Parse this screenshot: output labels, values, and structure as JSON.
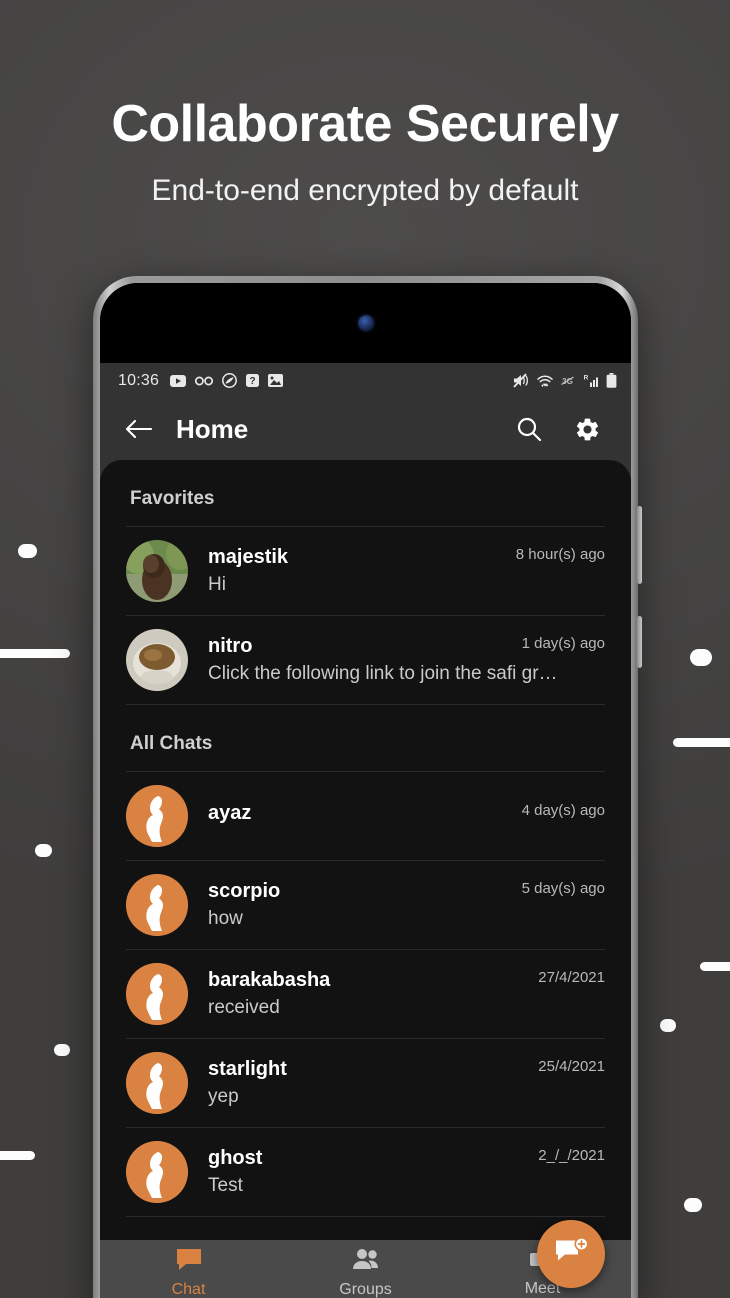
{
  "promo": {
    "headline": "Collaborate Securely",
    "subheadline": "End-to-end encrypted by default"
  },
  "colors": {
    "accent": "#d98242",
    "page_background": "#474645",
    "appbar_background": "#333333",
    "list_background": "#121212",
    "bottomnav_background": "#4a4a4a"
  },
  "phone": {
    "statusbar": {
      "time": "10:36",
      "left_icons": [
        "youtube-icon",
        "voicemail-icon",
        "shazam-icon",
        "question-mark-icon",
        "image-icon"
      ],
      "right_icons": [
        "mute-icon",
        "wifi-icon",
        "no-3g-icon",
        "signal-roaming-icon",
        "battery-icon"
      ]
    },
    "appbar": {
      "back_icon": "back-arrow-icon",
      "title": "Home",
      "search_icon": "search-icon",
      "settings_icon": "gear-icon"
    },
    "sections": [
      {
        "title": "Favorites",
        "rows": [
          {
            "name": "majestik",
            "message": "Hi",
            "time": "8 hour(s) ago",
            "avatar": "photo-person"
          },
          {
            "name": "nitro",
            "message": "Click the following link to join the safi gr…",
            "time": "1 day(s) ago",
            "avatar": "photo-food"
          }
        ]
      },
      {
        "title": "All Chats",
        "rows": [
          {
            "name": "ayaz",
            "message": "",
            "time": "4 day(s) ago",
            "avatar": "default-person"
          },
          {
            "name": "scorpio",
            "message": "how",
            "time": "5 day(s) ago",
            "avatar": "default-person"
          },
          {
            "name": "barakabasha",
            "message": "received",
            "time": "27/4/2021",
            "avatar": "default-person"
          },
          {
            "name": "starlight",
            "message": "yep",
            "time": "25/4/2021",
            "avatar": "default-person"
          },
          {
            "name": "ghost",
            "message": "Test",
            "time": "2_/_/2021",
            "avatar": "default-person"
          }
        ]
      }
    ],
    "fab": {
      "icon": "new-chat-icon"
    },
    "bottomnav": {
      "items": [
        {
          "label": "Chat",
          "icon": "chat-bubble-icon",
          "active": true
        },
        {
          "label": "Groups",
          "icon": "people-icon",
          "active": false
        },
        {
          "label": "Meet",
          "icon": "video-camera-icon",
          "active": false
        }
      ]
    }
  }
}
